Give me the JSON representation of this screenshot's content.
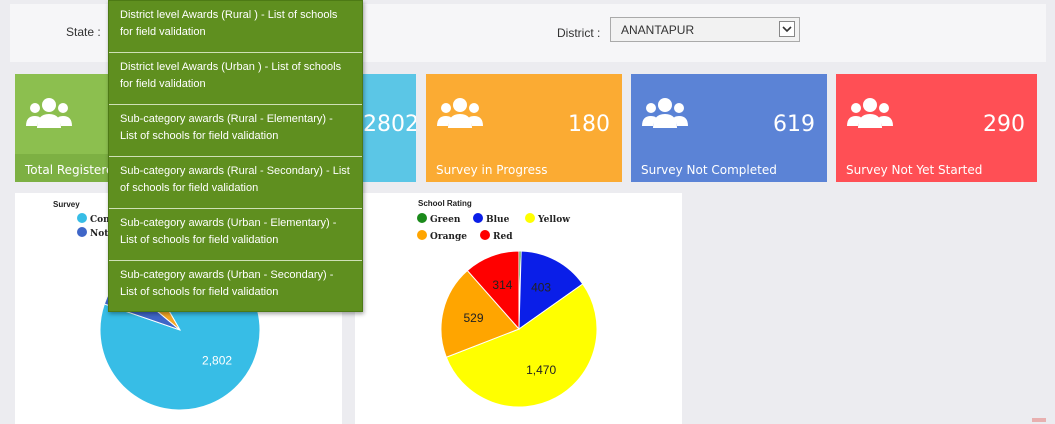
{
  "filters": {
    "state_label": "State :",
    "district_label": "District :",
    "district_value": "ANANTAPUR"
  },
  "cards": [
    {
      "label": "Total Registere",
      "count": "",
      "color": "#8cbf4f",
      "icon": "users-icon"
    },
    {
      "label": "",
      "count": "2802",
      "color": "#5bc6e6",
      "icon": "users-icon"
    },
    {
      "label": "Survey in Progress",
      "count": "180",
      "color": "#fbab33",
      "icon": "users-icon"
    },
    {
      "label": "Survey Not Completed",
      "count": "619",
      "color": "#5b83d6",
      "icon": "users-icon"
    },
    {
      "label": "Survey Not Yet Started",
      "count": "290",
      "color": "#ff4f55",
      "icon": "users-icon"
    }
  ],
  "menu": {
    "items": [
      "District level Awards (Rural ) - List of schools for field validation",
      "District level Awards (Urban ) - List of schools for field validation",
      "Sub-category awards (Rural - Elementary) - List of schools for field validation",
      "Sub-category awards (Rural - Secondary) - List of schools for field validation",
      "Sub-category awards (Urban - Elementary) - List of schools for field validation",
      "Sub-category awards (Urban - Secondary) - List of schools for field validation"
    ]
  },
  "survey_chart": {
    "title_partial": "Survey",
    "legend": [
      {
        "label": "Com",
        "color": "#37bde6"
      },
      {
        "label": "Not",
        "color": "#3f66c8"
      }
    ],
    "slice_label": "2,802"
  },
  "chart_data": [
    {
      "type": "pie",
      "title": "Survey",
      "categories": [
        "Com",
        "Not",
        ""
      ],
      "values": [
        2802,
        180,
        180
      ],
      "colors": [
        "#37bde6",
        "#3f66c8",
        "#f5a623"
      ],
      "visible_labels": [
        "2,802"
      ]
    },
    {
      "type": "pie",
      "title": "School Rating",
      "categories": [
        "Green",
        "Blue",
        "Yellow",
        "Orange",
        "Red"
      ],
      "values": [
        12,
        403,
        1470,
        529,
        314
      ],
      "value_labels": [
        "",
        "403",
        "1,470",
        "529",
        "314"
      ],
      "colors": [
        "#1b8a1b",
        "#0a1ee8",
        "#ffff00",
        "#ffa500",
        "#ff0000"
      ],
      "legend_placement": "top-left"
    }
  ]
}
